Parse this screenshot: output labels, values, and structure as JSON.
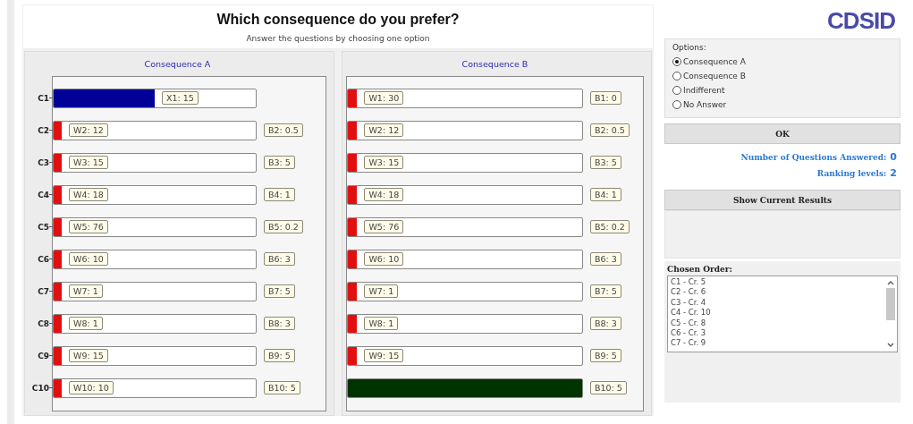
{
  "header": {
    "title": "Which consequence do you prefer?",
    "subtitle": "Answer the questions by choosing one option"
  },
  "consequences": [
    {
      "title": "Consequence A",
      "rows": [
        {
          "axis_label": "C1",
          "level": 0.5,
          "color": "#000099",
          "bar_label": "X1: 15"
        },
        {
          "axis_label": "C2",
          "level": 0.04,
          "color": "#e01010",
          "bar_label": "W2: 12",
          "side_label": "B2: 0.5"
        },
        {
          "axis_label": "C3",
          "level": 0.04,
          "color": "#e01010",
          "bar_label": "W3: 15",
          "side_label": "B3: 5"
        },
        {
          "axis_label": "C4",
          "level": 0.04,
          "color": "#e01010",
          "bar_label": "W4: 18",
          "side_label": "B4: 1"
        },
        {
          "axis_label": "C5",
          "level": 0.04,
          "color": "#e01010",
          "bar_label": "W5: 76",
          "side_label": "B5: 0.2"
        },
        {
          "axis_label": "C6",
          "level": 0.04,
          "color": "#e01010",
          "bar_label": "W6: 10",
          "side_label": "B6: 3"
        },
        {
          "axis_label": "C7",
          "level": 0.04,
          "color": "#e01010",
          "bar_label": "W7: 1",
          "side_label": "B7: 5"
        },
        {
          "axis_label": "C8",
          "level": 0.04,
          "color": "#e01010",
          "bar_label": "W8: 1",
          "side_label": "B8: 3"
        },
        {
          "axis_label": "C9",
          "level": 0.04,
          "color": "#e01010",
          "bar_label": "W9: 15",
          "side_label": "B9: 5"
        },
        {
          "axis_label": "C10",
          "level": 0.04,
          "color": "#e01010",
          "bar_label": "W10: 10",
          "side_label": "B10: 5"
        }
      ]
    },
    {
      "title": "Consequence B",
      "rows": [
        {
          "level": 0.04,
          "color": "#e01010",
          "bar_label": "W1: 30",
          "side_label": "B1: 0"
        },
        {
          "level": 0.04,
          "color": "#e01010",
          "bar_label": "W2: 12",
          "side_label": "B2: 0.5"
        },
        {
          "level": 0.04,
          "color": "#e01010",
          "bar_label": "W3: 15",
          "side_label": "B3: 5"
        },
        {
          "level": 0.04,
          "color": "#e01010",
          "bar_label": "W4: 18",
          "side_label": "B4: 1"
        },
        {
          "level": 0.04,
          "color": "#e01010",
          "bar_label": "W5: 76",
          "side_label": "B5: 0.2"
        },
        {
          "level": 0.04,
          "color": "#e01010",
          "bar_label": "W6: 10",
          "side_label": "B6: 3"
        },
        {
          "level": 0.04,
          "color": "#e01010",
          "bar_label": "W7: 1",
          "side_label": "B7: 5"
        },
        {
          "level": 0.04,
          "color": "#e01010",
          "bar_label": "W8: 1",
          "side_label": "B8: 3"
        },
        {
          "level": 0.04,
          "color": "#e01010",
          "bar_label": "W9: 15",
          "side_label": "B9: 5"
        },
        {
          "level": 1,
          "color": "#003300",
          "side_label": "B10: 5"
        }
      ]
    }
  ],
  "logo": "CDSID",
  "options": {
    "title": "Options:",
    "items": [
      {
        "label": "Consequence A",
        "selected": true
      },
      {
        "label": "Consequence B",
        "selected": false
      },
      {
        "label": "Indifferent",
        "selected": false
      },
      {
        "label": "No Answer",
        "selected": false
      }
    ]
  },
  "ok_button": "OK",
  "stats": [
    {
      "label": "Number of Questions Answered:",
      "value": "0"
    },
    {
      "label": "Ranking levels:",
      "value": "2"
    }
  ],
  "results_button": "Show Current Results",
  "chosen_order": {
    "title": "Chosen Order:",
    "items": [
      "C1 - Cr. 5",
      "C2 - Cr. 6",
      "C3 - Cr. 4",
      "C4 - Cr. 10",
      "C5 - Cr. 8",
      "C6 - Cr. 3",
      "C7 - Cr. 9"
    ]
  }
}
